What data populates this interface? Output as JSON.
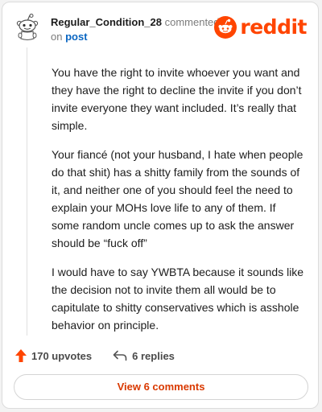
{
  "header": {
    "username": "Regular_Condition_28",
    "commented_text": "commented",
    "on_text": "on",
    "post_link": "post",
    "brand_name": "reddit",
    "brand_color": "#ff4500"
  },
  "comment": {
    "paragraphs": [
      "You have the right to invite whoever you want and they have the right to decline the invite if you don’t invite everyone they want included. It’s really that simple.",
      "Your fiancé (not your husband, I hate when people do that shit) has a shitty family from the sounds of it, and neither one of you should feel the need to explain your MOHs love life to any of them. If some random uncle comes up to ask the answer should be “fuck off”",
      "I would have to say YWBTA because it sounds like the decision not to invite them all would be to capitulate to shitty conservatives which is asshole behavior on principle."
    ]
  },
  "actions": {
    "upvotes_label": "170 upvotes",
    "replies_label": "6 replies",
    "upvote_icon": "upvote-arrow-icon",
    "reply_icon": "reply-arrow-icon",
    "upvote_color": "#ff4500"
  },
  "footer": {
    "view_comments_label": "View 6 comments",
    "link_color": "#d93900"
  }
}
